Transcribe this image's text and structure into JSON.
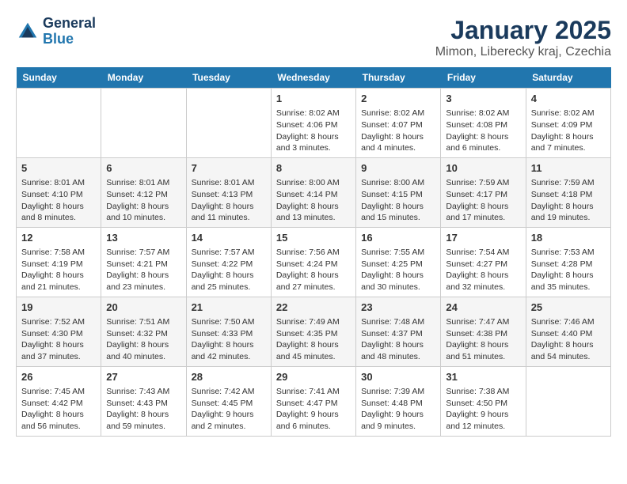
{
  "logo": {
    "line1": "General",
    "line2": "Blue"
  },
  "title": "January 2025",
  "subtitle": "Mimon, Liberecky kraj, Czechia",
  "days_of_week": [
    "Sunday",
    "Monday",
    "Tuesday",
    "Wednesday",
    "Thursday",
    "Friday",
    "Saturday"
  ],
  "weeks": [
    [
      {
        "day": "",
        "info": ""
      },
      {
        "day": "",
        "info": ""
      },
      {
        "day": "",
        "info": ""
      },
      {
        "day": "1",
        "info": "Sunrise: 8:02 AM\nSunset: 4:06 PM\nDaylight: 8 hours and 3 minutes."
      },
      {
        "day": "2",
        "info": "Sunrise: 8:02 AM\nSunset: 4:07 PM\nDaylight: 8 hours and 4 minutes."
      },
      {
        "day": "3",
        "info": "Sunrise: 8:02 AM\nSunset: 4:08 PM\nDaylight: 8 hours and 6 minutes."
      },
      {
        "day": "4",
        "info": "Sunrise: 8:02 AM\nSunset: 4:09 PM\nDaylight: 8 hours and 7 minutes."
      }
    ],
    [
      {
        "day": "5",
        "info": "Sunrise: 8:01 AM\nSunset: 4:10 PM\nDaylight: 8 hours and 8 minutes."
      },
      {
        "day": "6",
        "info": "Sunrise: 8:01 AM\nSunset: 4:12 PM\nDaylight: 8 hours and 10 minutes."
      },
      {
        "day": "7",
        "info": "Sunrise: 8:01 AM\nSunset: 4:13 PM\nDaylight: 8 hours and 11 minutes."
      },
      {
        "day": "8",
        "info": "Sunrise: 8:00 AM\nSunset: 4:14 PM\nDaylight: 8 hours and 13 minutes."
      },
      {
        "day": "9",
        "info": "Sunrise: 8:00 AM\nSunset: 4:15 PM\nDaylight: 8 hours and 15 minutes."
      },
      {
        "day": "10",
        "info": "Sunrise: 7:59 AM\nSunset: 4:17 PM\nDaylight: 8 hours and 17 minutes."
      },
      {
        "day": "11",
        "info": "Sunrise: 7:59 AM\nSunset: 4:18 PM\nDaylight: 8 hours and 19 minutes."
      }
    ],
    [
      {
        "day": "12",
        "info": "Sunrise: 7:58 AM\nSunset: 4:19 PM\nDaylight: 8 hours and 21 minutes."
      },
      {
        "day": "13",
        "info": "Sunrise: 7:57 AM\nSunset: 4:21 PM\nDaylight: 8 hours and 23 minutes."
      },
      {
        "day": "14",
        "info": "Sunrise: 7:57 AM\nSunset: 4:22 PM\nDaylight: 8 hours and 25 minutes."
      },
      {
        "day": "15",
        "info": "Sunrise: 7:56 AM\nSunset: 4:24 PM\nDaylight: 8 hours and 27 minutes."
      },
      {
        "day": "16",
        "info": "Sunrise: 7:55 AM\nSunset: 4:25 PM\nDaylight: 8 hours and 30 minutes."
      },
      {
        "day": "17",
        "info": "Sunrise: 7:54 AM\nSunset: 4:27 PM\nDaylight: 8 hours and 32 minutes."
      },
      {
        "day": "18",
        "info": "Sunrise: 7:53 AM\nSunset: 4:28 PM\nDaylight: 8 hours and 35 minutes."
      }
    ],
    [
      {
        "day": "19",
        "info": "Sunrise: 7:52 AM\nSunset: 4:30 PM\nDaylight: 8 hours and 37 minutes."
      },
      {
        "day": "20",
        "info": "Sunrise: 7:51 AM\nSunset: 4:32 PM\nDaylight: 8 hours and 40 minutes."
      },
      {
        "day": "21",
        "info": "Sunrise: 7:50 AM\nSunset: 4:33 PM\nDaylight: 8 hours and 42 minutes."
      },
      {
        "day": "22",
        "info": "Sunrise: 7:49 AM\nSunset: 4:35 PM\nDaylight: 8 hours and 45 minutes."
      },
      {
        "day": "23",
        "info": "Sunrise: 7:48 AM\nSunset: 4:37 PM\nDaylight: 8 hours and 48 minutes."
      },
      {
        "day": "24",
        "info": "Sunrise: 7:47 AM\nSunset: 4:38 PM\nDaylight: 8 hours and 51 minutes."
      },
      {
        "day": "25",
        "info": "Sunrise: 7:46 AM\nSunset: 4:40 PM\nDaylight: 8 hours and 54 minutes."
      }
    ],
    [
      {
        "day": "26",
        "info": "Sunrise: 7:45 AM\nSunset: 4:42 PM\nDaylight: 8 hours and 56 minutes."
      },
      {
        "day": "27",
        "info": "Sunrise: 7:43 AM\nSunset: 4:43 PM\nDaylight: 8 hours and 59 minutes."
      },
      {
        "day": "28",
        "info": "Sunrise: 7:42 AM\nSunset: 4:45 PM\nDaylight: 9 hours and 2 minutes."
      },
      {
        "day": "29",
        "info": "Sunrise: 7:41 AM\nSunset: 4:47 PM\nDaylight: 9 hours and 6 minutes."
      },
      {
        "day": "30",
        "info": "Sunrise: 7:39 AM\nSunset: 4:48 PM\nDaylight: 9 hours and 9 minutes."
      },
      {
        "day": "31",
        "info": "Sunrise: 7:38 AM\nSunset: 4:50 PM\nDaylight: 9 hours and 12 minutes."
      },
      {
        "day": "",
        "info": ""
      }
    ]
  ]
}
